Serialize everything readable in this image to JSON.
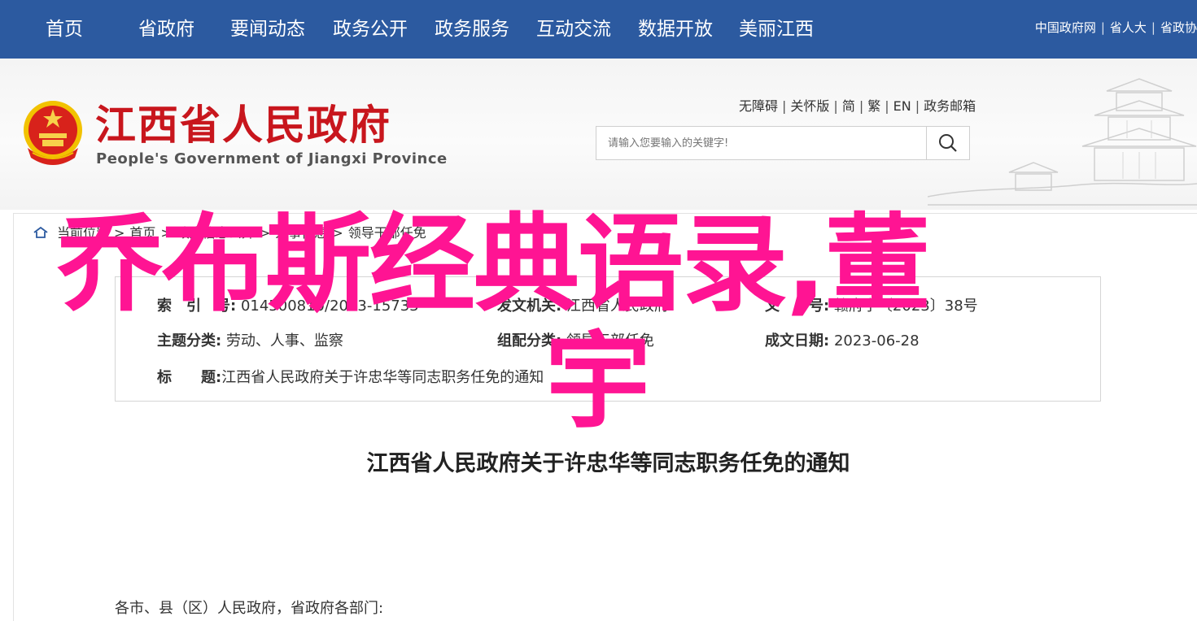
{
  "topnav": {
    "items": [
      "首页",
      "省政府",
      "要闻动态",
      "政务公开",
      "政务服务",
      "互动交流",
      "数据开放",
      "美丽江西"
    ],
    "right_links": [
      "中国政府网",
      "省人大",
      "省政协"
    ]
  },
  "header": {
    "title": "江西省人民政府",
    "subtitle": "People's Government of Jiangxi Province",
    "utility_links": [
      "无障碍",
      "关怀版",
      "简",
      "繁",
      "EN",
      "政务邮箱"
    ],
    "search_placeholder": "请输入您要输入的关键字!"
  },
  "breadcrumb": {
    "items": [
      "当前位置",
      "首页",
      "政府信息公开",
      "人事信息",
      "领导干部任免"
    ]
  },
  "meta": {
    "index_label": "索　引　号:",
    "index_value": "014500810/2023-15733",
    "issuer_label": "发文机关:",
    "issuer_value": "江西省人民政府",
    "docno_label": "文　　号:",
    "docno_value": "赣府字〔2023〕38号",
    "topic_label": "主题分类:",
    "topic_value": "劳动、人事、监察",
    "category_label": "组配分类:",
    "category_value": "领导干部任免",
    "date_label": "成文日期:",
    "date_value": "2023-06-28",
    "subject_label": "标　　题:",
    "subject_value": "江西省人民政府关于许忠华等同志职务任免的通知"
  },
  "document": {
    "title": "江西省人民政府关于许忠华等同志职务任免的通知",
    "salutation": "各市、县（区）人民政府，省政府各部门:"
  },
  "overlay": {
    "line1": "乔布斯经典语录,董",
    "line2": "宇"
  },
  "colors": {
    "nav_bg": "#2c5aa0",
    "title_red": "#c8161d",
    "overlay_pink": "#ff1493"
  }
}
